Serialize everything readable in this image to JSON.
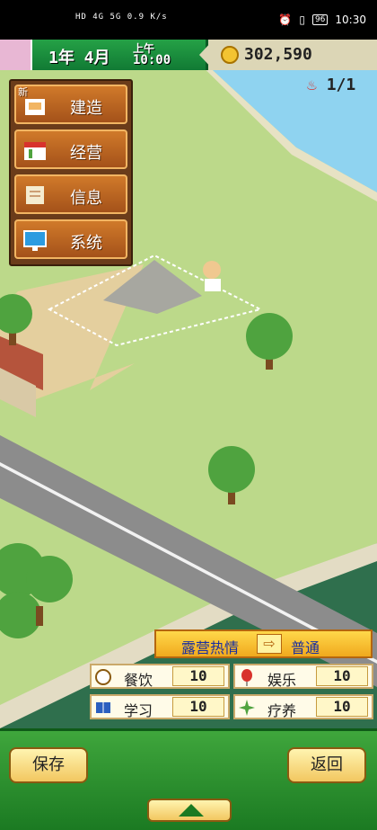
{
  "status_bar": {
    "left_text": "HD 4G 5G 0.9 K/s",
    "time": "10:30",
    "battery": "96"
  },
  "hud": {
    "date": "1年  4月",
    "period": "上午",
    "clock": "10:00",
    "money": "302,590",
    "rank_text": "1/1"
  },
  "menu": {
    "new_badge": "新",
    "items": [
      {
        "label": "建造"
      },
      {
        "label": "经营"
      },
      {
        "label": "信息"
      },
      {
        "label": "系统"
      }
    ]
  },
  "camp": {
    "label": "露营热情",
    "value": "普通"
  },
  "stats": [
    {
      "label": "餐饮",
      "value": "10"
    },
    {
      "label": "娱乐",
      "value": "10"
    },
    {
      "label": "学习",
      "value": "10"
    },
    {
      "label": "疗养",
      "value": "10"
    }
  ],
  "bottom": {
    "save_label": "保存",
    "back_label": "返回"
  },
  "colors": {
    "grass": "#bcd98a",
    "water": "#8fd3f0",
    "road": "#8c8c8c",
    "hud_green": "#25a146",
    "menu_brown": "#6b3c1a",
    "bottom_green": "#2e8f30"
  }
}
